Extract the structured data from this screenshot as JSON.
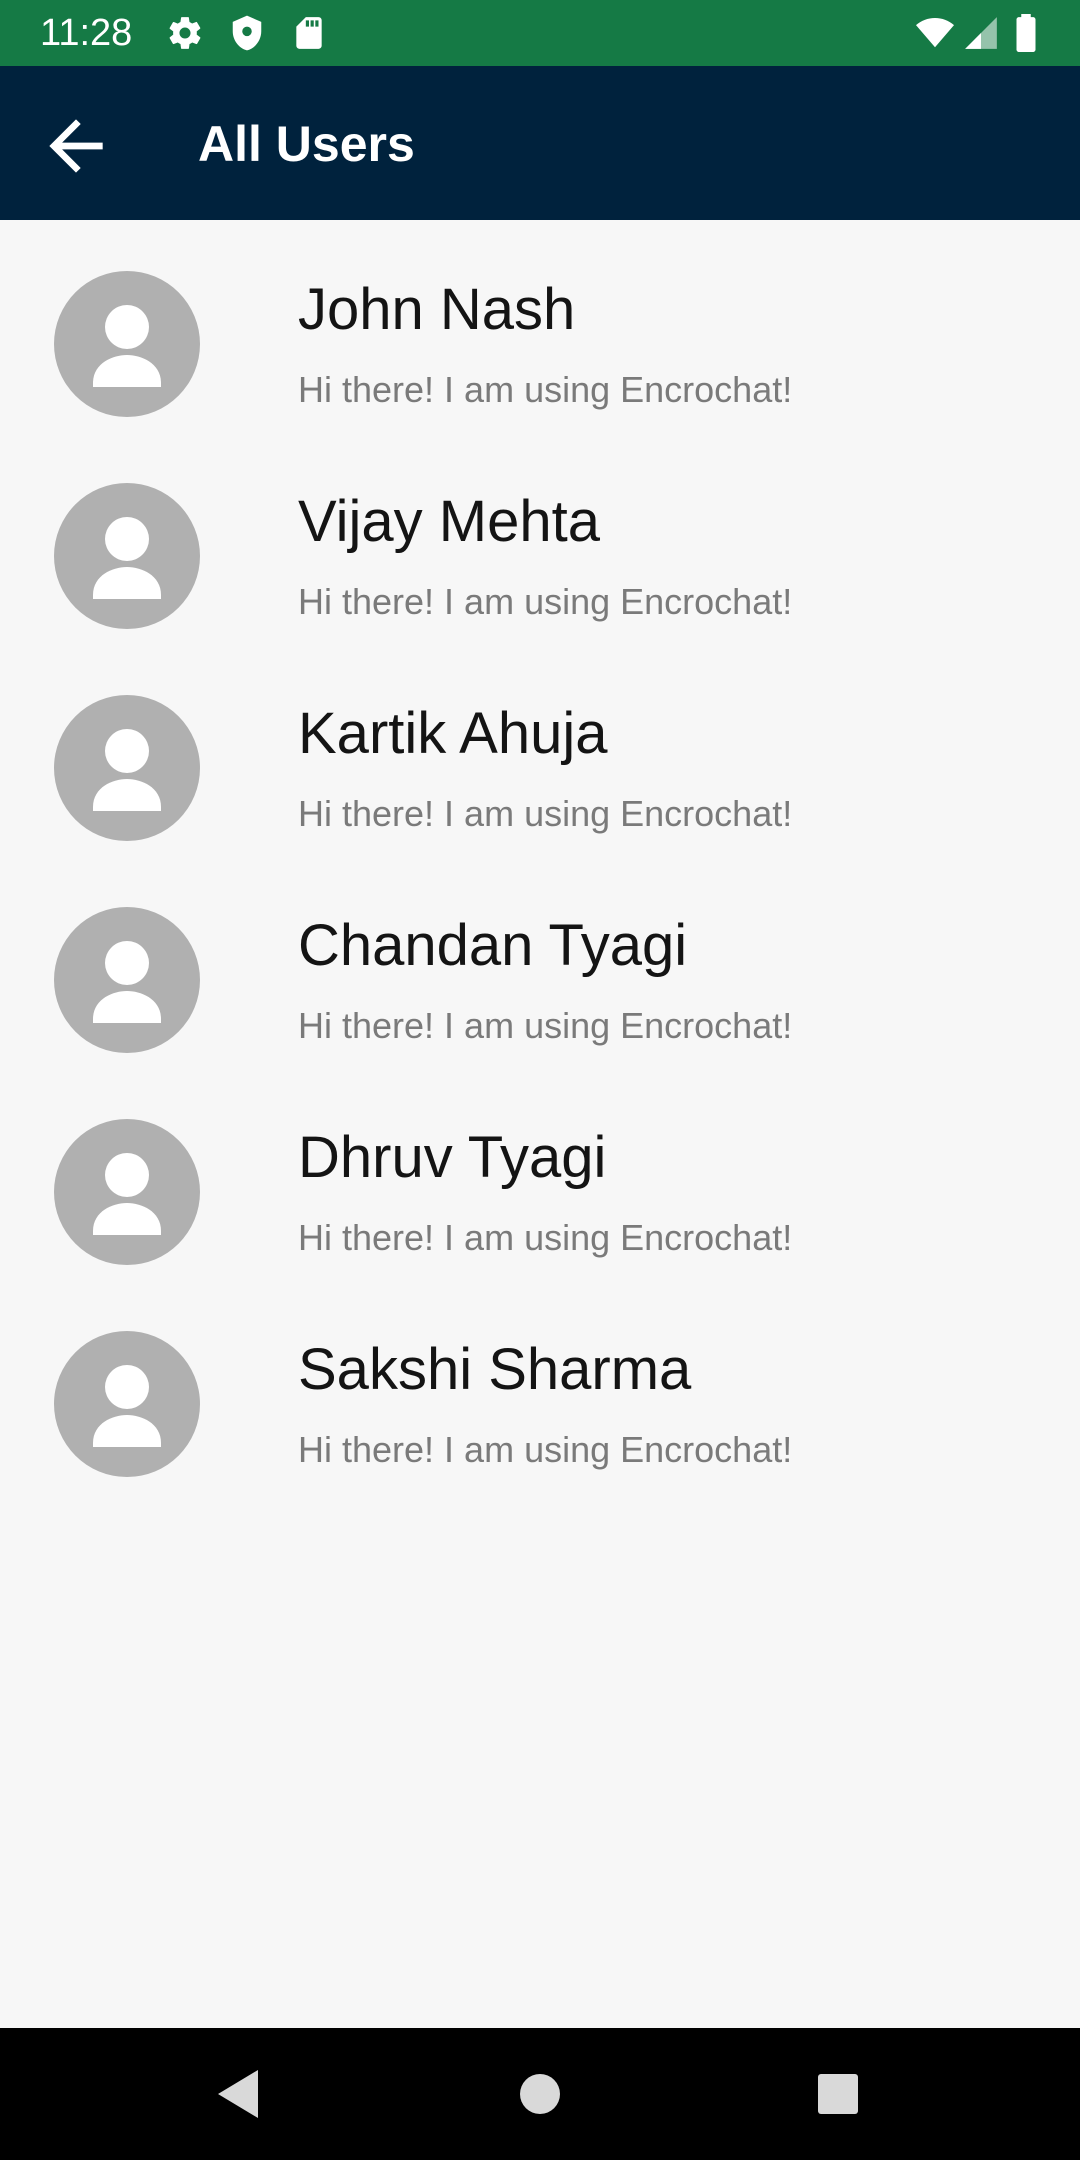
{
  "status_bar": {
    "time": "11:28",
    "background": "#157a45",
    "icons": [
      "settings-icon",
      "shield-icon",
      "sd-card-icon",
      "wifi-icon",
      "signal-icon",
      "battery-icon"
    ]
  },
  "app_bar": {
    "title": "All Users",
    "background": "#00223d",
    "back_icon": "arrow-back-icon"
  },
  "users": [
    {
      "name": "John Nash",
      "status": "Hi there! I am using Encrochat!"
    },
    {
      "name": "Vijay Mehta",
      "status": "Hi there! I am using Encrochat!"
    },
    {
      "name": "Kartik Ahuja",
      "status": "Hi there! I am using Encrochat!"
    },
    {
      "name": "Chandan Tyagi",
      "status": "Hi there! I am using Encrochat!"
    },
    {
      "name": "Dhruv Tyagi",
      "status": "Hi there! I am using Encrochat!"
    },
    {
      "name": "Sakshi Sharma",
      "status": "Hi there! I am using Encrochat!"
    }
  ],
  "nav_bar": {
    "buttons": [
      "back-triangle-icon",
      "home-circle-icon",
      "recents-square-icon"
    ]
  }
}
